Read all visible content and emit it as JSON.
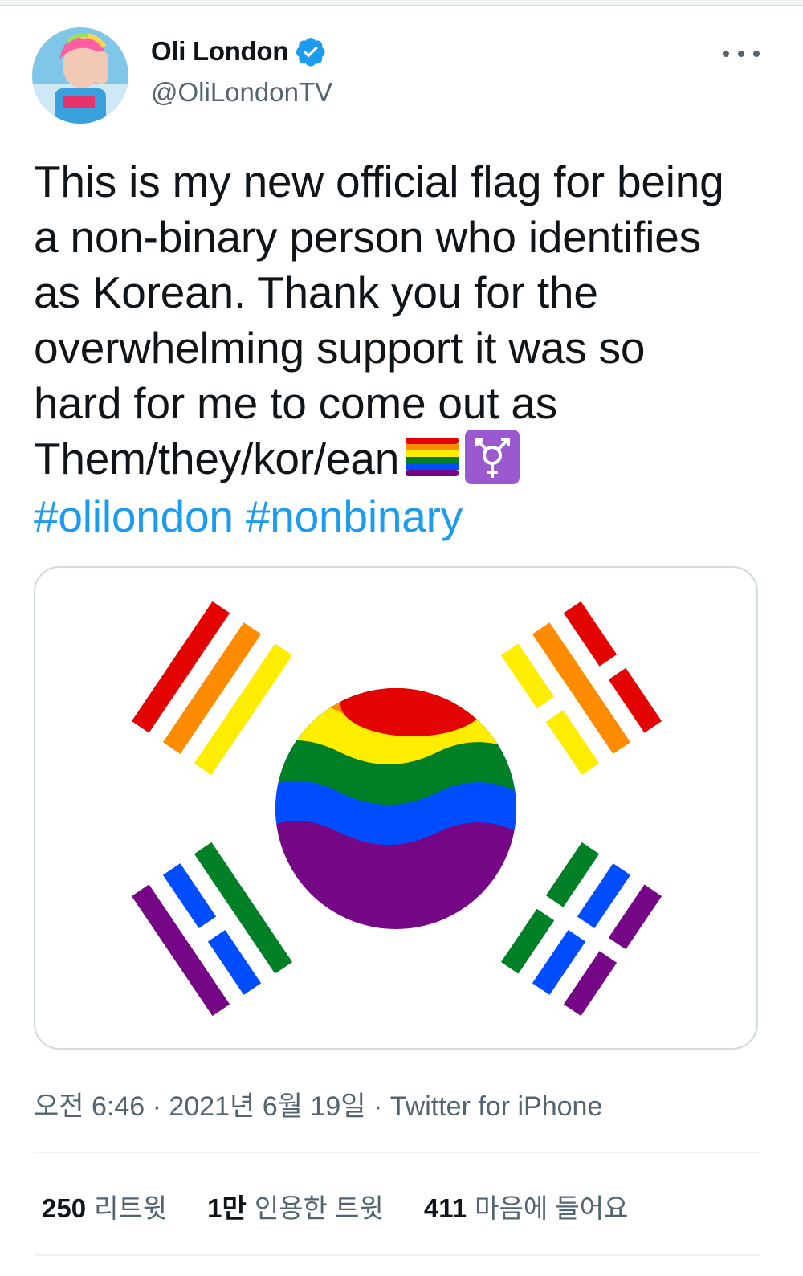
{
  "author": {
    "name": "Oli London",
    "handle": "@OliLondonTV",
    "verified": true,
    "verified_color": "#1d9bf0"
  },
  "tweet": {
    "lines": [
      "This is my new official flag for being",
      "a non-binary person who identifies",
      "as Korean.  Thank you for the",
      "overwhelming support it was so",
      "hard for me to come out as",
      "Them/they/kor/ean"
    ],
    "emojis": [
      "rainbow-flag-icon",
      "transgender-symbol-icon"
    ],
    "hashtags": [
      "#olilondon",
      "#nonbinary"
    ]
  },
  "meta": {
    "time": "오전 6:46",
    "date": "2021년 6월 19일",
    "source": "Twitter for iPhone",
    "separator": "·"
  },
  "stats": [
    {
      "count": "250",
      "label": "리트윗"
    },
    {
      "count": "1만",
      "label": "인용한 트윗"
    },
    {
      "count": "411",
      "label": "마음에 들어요"
    }
  ],
  "colors": {
    "text": "#0f1419",
    "secondary": "#536471",
    "link": "#1d9bf0",
    "border": "#cfd9de",
    "rainbow": [
      "#e40303",
      "#ff8c00",
      "#ffed00",
      "#008026",
      "#004dff",
      "#750787"
    ]
  }
}
